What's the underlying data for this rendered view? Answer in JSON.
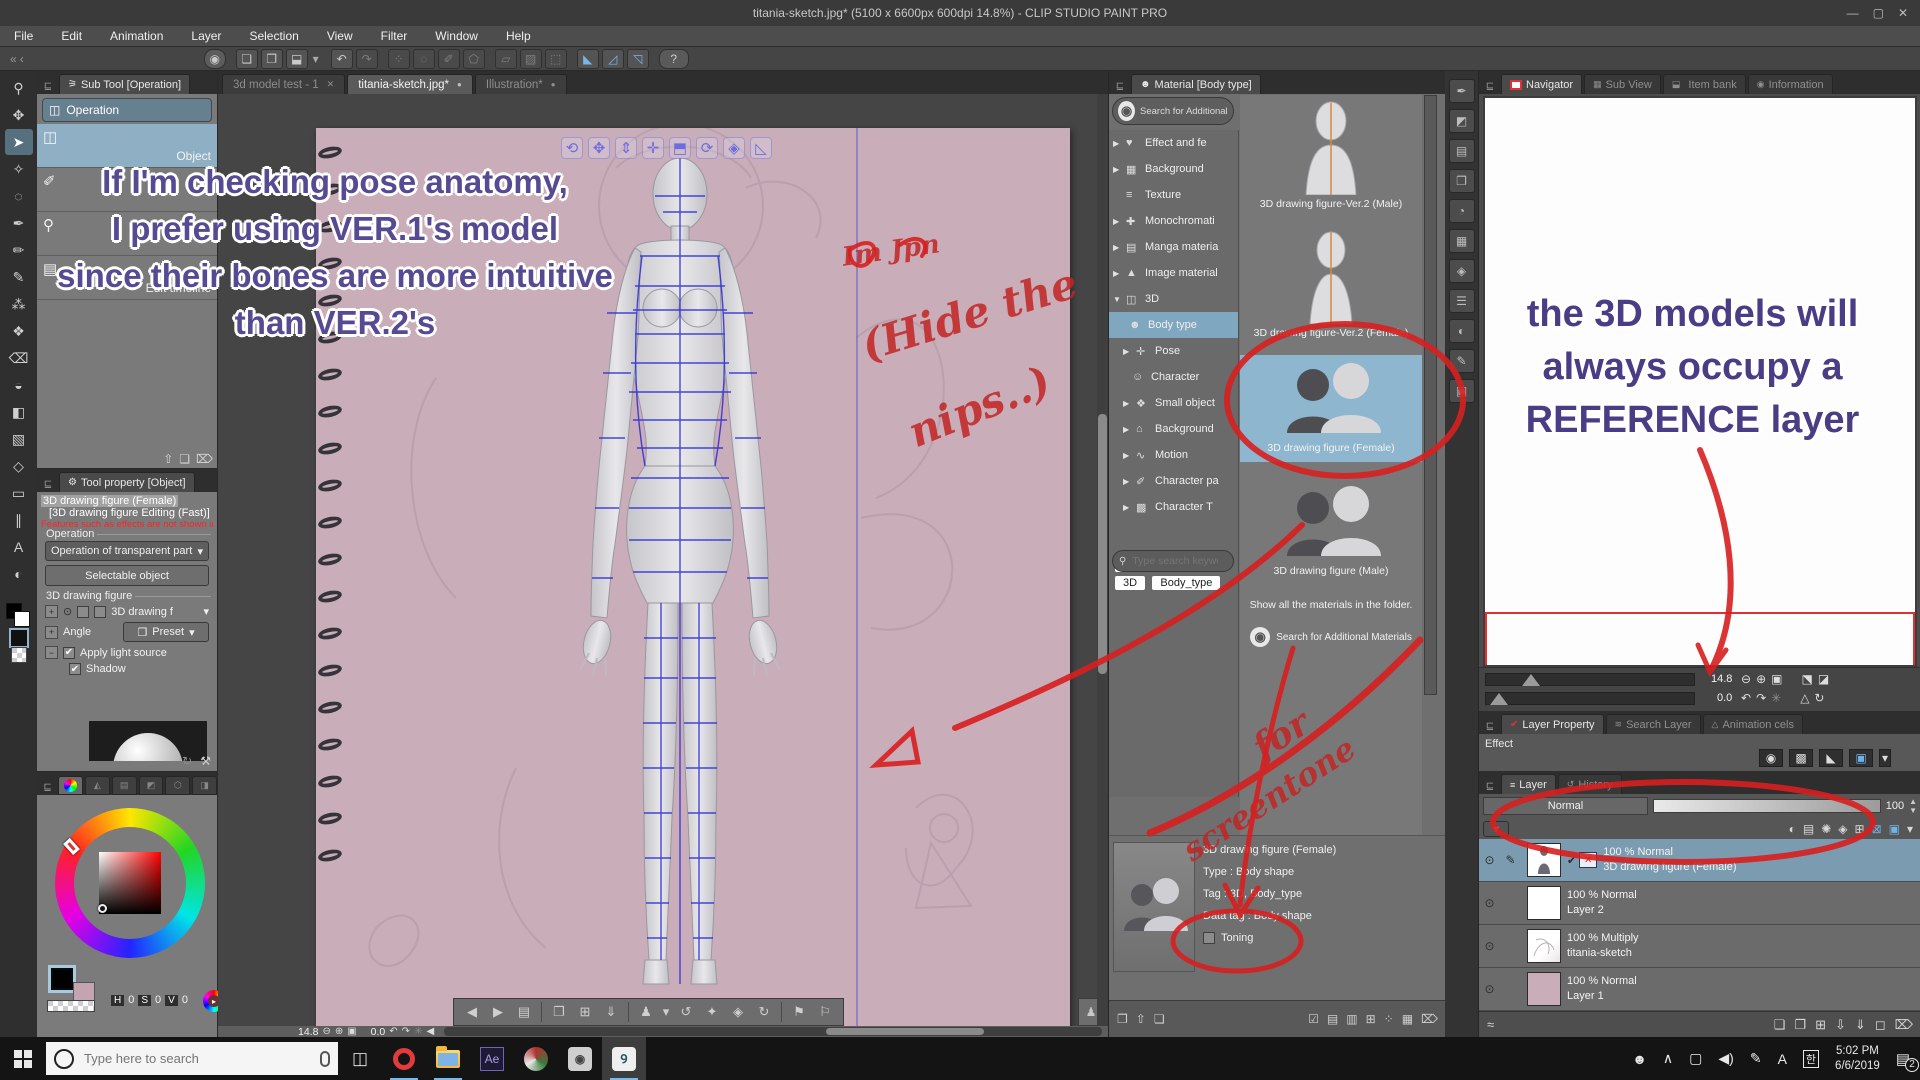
{
  "window": {
    "title": "titania-sketch.jpg* (5100 x 6600px 600dpi 14.8%)  - CLIP STUDIO PAINT PRO",
    "controls": {
      "minimize": "—",
      "maximize": "▢",
      "close": "✕"
    }
  },
  "menu": {
    "items": [
      "File",
      "Edit",
      "Animation",
      "Layer",
      "Selection",
      "View",
      "Filter",
      "Window",
      "Help"
    ]
  },
  "commandbar": {
    "glyphs": [
      "◉",
      "❏",
      "❐",
      "⬓",
      "▾",
      "↶",
      "↷",
      "⁘",
      "◌",
      "✐",
      "⬠",
      "▱",
      "▨",
      "⬚",
      "◣",
      "◿",
      "◹",
      "?"
    ],
    "nav_back": "«",
    "nav_back2": "‹"
  },
  "toolstrip": {
    "glyphs": [
      "⚲",
      "✥",
      "➤",
      "✧",
      "◌",
      "✒",
      "✏",
      "✎",
      "⁂",
      "❖",
      "⌫",
      "◒",
      "◧",
      "▧",
      "◇",
      "▭",
      "∥",
      "A",
      "◐"
    ]
  },
  "doc_tabs": {
    "tabs": [
      {
        "label": "3d model test - 1",
        "close": "✕"
      },
      {
        "label": "titania-sketch.jpg*",
        "dot": "●"
      },
      {
        "label": "Illustration*",
        "dot": "●"
      }
    ]
  },
  "canvas_status": {
    "zoom": "14.8",
    "rotation": "0.0"
  },
  "gizmo": {
    "glyphs": [
      "⟲",
      "✥",
      "⇕",
      "✛",
      "⬒",
      "⟳",
      "◈",
      "◺"
    ]
  },
  "launcher": {
    "glyphs": [
      "◀",
      "▶",
      "▤",
      "❐",
      "⊞",
      "⇓",
      "♟",
      "▾",
      "↺",
      "✦",
      "◈",
      "↻",
      "⚑",
      "⚐"
    ],
    "side": "♟"
  },
  "subtool": {
    "header": "Sub Tool [Operation]",
    "group": "Operation",
    "items": [
      {
        "label": "Object",
        "glyph": "◫"
      },
      {
        "label": "",
        "glyph": "✐"
      },
      {
        "label": "",
        "glyph": "⚲"
      },
      {
        "label": "Edit timeline",
        "glyph": "▤"
      }
    ],
    "foot": [
      "⇧",
      "❏",
      "⌦"
    ]
  },
  "toolprop": {
    "header": "Tool property [Object]",
    "target": "3D drawing figure (Female)",
    "mode": "[3D drawing figure Editing (Fast)]",
    "warning": "Features such as effects are not shown in the Fa",
    "operation_group": "Operation",
    "transparent_dropdown": "Operation of transparent part",
    "selectable_button": "Selectable object",
    "figure_group": "3D drawing figure",
    "figure_dropdown": "3D drawing f",
    "angle_label": "Angle",
    "preset_label": "Preset",
    "light_label": "Apply light source",
    "shadow_label": "Shadow",
    "check": "✔"
  },
  "color": {
    "h_label": "H",
    "h": "0",
    "s_label": "S",
    "s": "0",
    "v_label": "V",
    "v": "0"
  },
  "material": {
    "header": "Material [Body type]",
    "search_button": "Search for Additional Ma",
    "tree": [
      {
        "arrow": "▶",
        "glyph": "♥",
        "label": "Effect and fe"
      },
      {
        "arrow": "▶",
        "glyph": "▦",
        "label": "Background"
      },
      {
        "arrow": "",
        "glyph": "≡",
        "label": "Texture"
      },
      {
        "arrow": "▶",
        "glyph": "✚",
        "label": "Monochromati"
      },
      {
        "arrow": "▶",
        "glyph": "▤",
        "label": "Manga materia"
      },
      {
        "arrow": "▶",
        "glyph": "▲",
        "label": "Image material"
      },
      {
        "arrow": "▼",
        "glyph": "◫",
        "label": "3D"
      },
      {
        "arrow": "",
        "glyph": "☻",
        "label": "Body type",
        "selected": true
      },
      {
        "arrow": "▶",
        "glyph": "✛",
        "label": "Pose"
      },
      {
        "arrow": "",
        "glyph": "☺",
        "label": "Character"
      },
      {
        "arrow": "▶",
        "glyph": "❖",
        "label": "Small object"
      },
      {
        "arrow": "▶",
        "glyph": "⌂",
        "label": "Background"
      },
      {
        "arrow": "▶",
        "glyph": "∿",
        "label": "Motion"
      },
      {
        "arrow": "▶",
        "glyph": "✐",
        "label": "Character pa"
      },
      {
        "arrow": "▶",
        "glyph": "▩",
        "label": "Character T"
      }
    ],
    "search_placeholder": "Type search keywords",
    "tags": [
      "Body shape",
      "3D",
      "Body_type"
    ],
    "items": [
      {
        "name": "3D drawing figure-Ver.2 (Male)"
      },
      {
        "name": "3D drawing figure-Ver.2 (Female)"
      },
      {
        "name": "3D drawing figure (Female)",
        "selected": true
      },
      {
        "name": "3D drawing figure (Male)"
      }
    ],
    "show_all": "Show all the materials in the folder.",
    "search_more": "Search for Additional Materials",
    "detail": {
      "name": "3D drawing figure (Female)",
      "type": "Type : Body shape",
      "tag": "Tag : 3D, Body_type",
      "data_tag": "Data tag : Body shape",
      "toning": "Toning"
    },
    "foot_left": [
      "❐",
      "⇧",
      "❏"
    ],
    "foot_right": [
      "☑",
      "▤",
      "▥",
      "⊞",
      "⁘",
      "▦",
      "⌦"
    ]
  },
  "navigator": {
    "tabs": [
      "Navigator",
      "Sub View",
      "Item bank",
      "Information"
    ],
    "zoom": "14.8",
    "rotation": "0.0",
    "icons_row1": [
      "⊖",
      "⊕",
      "▣",
      "⬔",
      "◪"
    ],
    "icons_row2": [
      "↶",
      "↷",
      "✳",
      "△",
      "↻"
    ]
  },
  "layer_property": {
    "tabs": [
      "Layer Property",
      "Search Layer",
      "Animation cels"
    ],
    "effect_label": "Effect",
    "icons": [
      "◉",
      "▩",
      "◣",
      "▣",
      "▾"
    ]
  },
  "layers": {
    "tabs": [
      "Layer",
      "History"
    ],
    "blend": "Normal",
    "opacity": "100",
    "bar_icons": [
      "◐",
      "▤",
      "✺",
      "◈",
      "⊞",
      "⊠",
      "▣",
      "▾"
    ],
    "rows": [
      {
        "meta": "100 % Normal",
        "name": "3D drawing figure (Female)",
        "selected": true,
        "check": "✔"
      },
      {
        "meta": "100 % Normal",
        "name": "Layer 2"
      },
      {
        "meta": "100 % Multiply",
        "name": "titania-sketch"
      },
      {
        "meta": "100 % Normal",
        "name": "Layer 1"
      }
    ],
    "foot_icons": [
      "≈",
      "❏",
      "❐",
      "⊞",
      "⇩",
      "⇓",
      "◻",
      "⌦"
    ]
  },
  "taskbar": {
    "search_placeholder": "Type here to search",
    "ae_label": "Ae",
    "tray": [
      "☻",
      "∧",
      "▢",
      "◀)",
      "✎",
      "A",
      "한"
    ],
    "time": "5:02 PM",
    "date": "6/6/2019",
    "badge": "2"
  },
  "notes": {
    "left": {
      "lines": [
        "If I'm checking pose anatomy,",
        "I prefer using VER.1's model",
        "since their bones are more intuitive",
        "than VER.2's"
      ]
    },
    "right": {
      "lines": [
        "the 3D models will",
        "always occupy a",
        "REFERENCE layer"
      ]
    },
    "red": {
      "scribble": "Im Jpn",
      "hide1": "(Hide the",
      "hide2": "nips..)",
      "for1": "for",
      "for2": "screentone"
    }
  },
  "colors": {
    "accent_blue": "#7fa7c0",
    "annotation_red": "#d81f1f",
    "note_purple": "#564a92",
    "page_pink": "#c9adb9"
  }
}
